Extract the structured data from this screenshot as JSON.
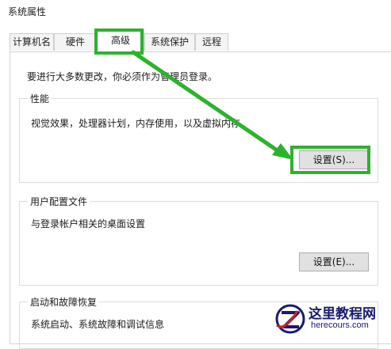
{
  "window": {
    "title": "系统属性"
  },
  "tabs": [
    {
      "label": "计算机名",
      "active": false
    },
    {
      "label": "硬件",
      "active": false
    },
    {
      "label": "高级",
      "active": true
    },
    {
      "label": "系统保护",
      "active": false
    },
    {
      "label": "远程",
      "active": false
    }
  ],
  "notice": "要进行大多数更改，你必须作为管理员登录。",
  "groups": {
    "performance": {
      "title": "性能",
      "description": "视觉效果，处理器计划，内存使用，以及虚拟内存",
      "button": "设置(S)..."
    },
    "user_profiles": {
      "title": "用户配置文件",
      "description": "与登录帐户相关的桌面设置",
      "button": "设置(E)..."
    },
    "startup_recovery": {
      "title": "启动和故障恢复",
      "description": "系统启动、系统故障和调试信息"
    }
  },
  "annotation": {
    "color": "#2db22d"
  },
  "watermark": {
    "site_name": "这里教程网",
    "url": "herecours.com"
  }
}
